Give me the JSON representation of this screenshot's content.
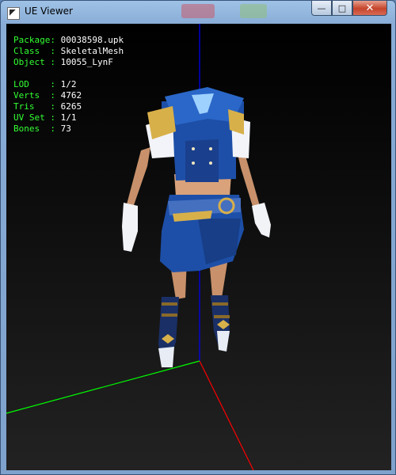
{
  "window": {
    "title": "UE Viewer"
  },
  "caption_buttons": {
    "minimize": "—",
    "maximize": "□",
    "close": "✕"
  },
  "icons": {
    "app": "viewer-icon",
    "minimize": "minimize-icon",
    "maximize": "maximize-icon",
    "close": "close-icon"
  },
  "info": {
    "package": {
      "label": "Package: ",
      "value": "00038598.upk"
    },
    "class": {
      "label": "Class  : ",
      "value": "SkeletalMesh"
    },
    "object": {
      "label": "Object : ",
      "value": "10055_LynF"
    },
    "lod": {
      "label": "LOD    : ",
      "value": "1/2"
    },
    "verts": {
      "label": "Verts  : ",
      "value": "4762"
    },
    "tris": {
      "label": "Tris   : ",
      "value": "6265"
    },
    "uvset": {
      "label": "UV Set : ",
      "value": "1/1"
    },
    "bones": {
      "label": "Bones  : ",
      "value": "73"
    }
  },
  "colors": {
    "info_label": "#33ff33",
    "info_value": "#ffffff",
    "axis_x": "#ff0000",
    "axis_y": "#00ff00",
    "axis_z": "#0000ff",
    "outfit_blue": "#1d4fa8",
    "skin": "#d9a27a",
    "gold": "#d8b04a"
  }
}
